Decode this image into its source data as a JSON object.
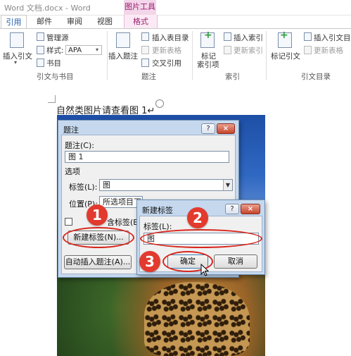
{
  "titlebar": {
    "title": "Word 文档.docx - Word",
    "contextual_tab_group": "图片工具"
  },
  "tabs": [
    {
      "label": "引用",
      "active": true
    },
    {
      "label": "邮件",
      "active": false
    },
    {
      "label": "审阅",
      "active": false
    },
    {
      "label": "视图",
      "active": false
    },
    {
      "label": "格式",
      "active": false
    }
  ],
  "ribbon": {
    "citations": {
      "insert_citation": "插入引文",
      "manage_sources": "管理源",
      "style_label": "样式:",
      "style_value": "APA",
      "bibliography": "书目",
      "group_label": "引文与书目"
    },
    "captions": {
      "insert_caption": "插入题注",
      "insert_table_of_figures": "插入表目录",
      "update_table": "更新表格",
      "cross_reference": "交叉引用",
      "group_label": "题注"
    },
    "index": {
      "mark_entry": "标记\n索引项",
      "mark_entry_line1": "标记",
      "mark_entry_line2": "索引项",
      "insert_index": "插入索引",
      "update_index": "更新索引",
      "group_label": "索引"
    },
    "table_of_authorities": {
      "mark_citation": "标记引文",
      "insert_toa": "插入引文目录",
      "update_table": "更新表格",
      "group_label": "引文目录"
    }
  },
  "document": {
    "text": "自然类图片请查看图 1↵"
  },
  "caption_dialog": {
    "title": "题注",
    "help": "?",
    "close": "×",
    "caption_label": "题注(C):",
    "caption_value": "图 1",
    "options_label": "选项",
    "label_label": "标签(L):",
    "label_value": "图",
    "position_label": "位置(P):",
    "position_value": "所选项目下",
    "exclude_label_text": "从题注中排除标签(E)",
    "exclude_label_visible": "含标签(E",
    "new_label_button": "新建标签(N)...",
    "autocaption_button": "自动插入题注(A)..."
  },
  "new_label_dialog": {
    "title": "新建标签",
    "help": "?",
    "close": "×",
    "label_label": "标签(L):",
    "label_value": "图",
    "ok_button": "确定",
    "cancel_button": "取消"
  },
  "annotations": {
    "step1": "1",
    "step2": "2",
    "step3": "3",
    "color": "#e23a2e"
  }
}
